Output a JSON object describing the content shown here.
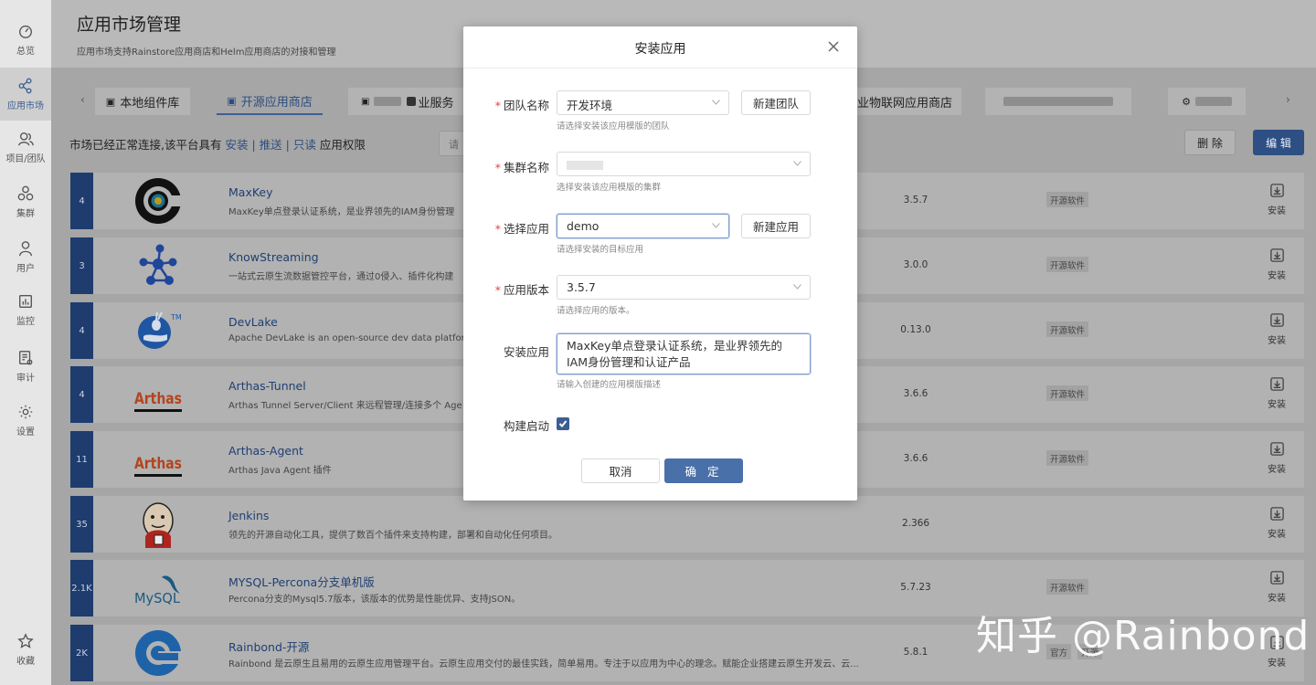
{
  "sidebar": {
    "items": [
      {
        "label": "总览",
        "icon": "dashboard-icon"
      },
      {
        "label": "应用市场",
        "icon": "share-icon"
      },
      {
        "label": "项目/团队",
        "icon": "team-icon"
      },
      {
        "label": "集群",
        "icon": "cluster-icon"
      },
      {
        "label": "用户",
        "icon": "user-icon"
      },
      {
        "label": "监控",
        "icon": "monitor-icon"
      },
      {
        "label": "审计",
        "icon": "audit-icon"
      },
      {
        "label": "设置",
        "icon": "gear-icon"
      },
      {
        "label": "收藏",
        "icon": "star-icon"
      }
    ]
  },
  "header": {
    "title": "应用市场管理",
    "description": "应用市场支持Rainstore应用商店和Helm应用商店的对接和管理"
  },
  "tabs": {
    "local": "本地组件库",
    "open_source": "开源应用商店",
    "partial_service": "业服务",
    "iot": "业物联网应用商店"
  },
  "permissions": {
    "prefix": "市场已经正常连接,该平台具有",
    "install": "安装",
    "push": "推送",
    "readonly": "只读",
    "suffix": "应用权限",
    "sep": "|"
  },
  "search": {
    "placeholder": "请"
  },
  "toolbar": {
    "delete": "删 除",
    "edit": "编 辑"
  },
  "apps": [
    {
      "count": "4",
      "name": "MaxKey",
      "desc": "MaxKey单点登录认证系统，是业界领先的IAM身份管理",
      "version": "3.5.7",
      "tags": [
        "开源软件"
      ],
      "install": "安装"
    },
    {
      "count": "3",
      "name": "KnowStreaming",
      "desc": "一站式云原生流数据管控平台，通过0侵入、插件化构建",
      "version": "3.0.0",
      "tags": [
        "开源软件"
      ],
      "install": "安装"
    },
    {
      "count": "4",
      "name": "DevLake",
      "desc": "Apache DevLake is an open-source dev data platform",
      "version": "0.13.0",
      "tags": [
        "开源软件"
      ],
      "install": "安装"
    },
    {
      "count": "4",
      "name": "Arthas-Tunnel",
      "desc": "Arthas Tunnel Server/Client 来远程管理/连接多个 Age",
      "version": "3.6.6",
      "tags": [
        "开源软件"
      ],
      "install": "安装"
    },
    {
      "count": "11",
      "name": "Arthas-Agent",
      "desc": "Arthas Java Agent 插件",
      "version": "3.6.6",
      "tags": [
        "开源软件"
      ],
      "install": "安装"
    },
    {
      "count": "35",
      "name": "Jenkins",
      "desc": "领先的开源自动化工具，提供了数百个插件来支持构建，部署和自动化任何项目。",
      "version": "2.366",
      "tags": [],
      "install": "安装"
    },
    {
      "count": "2.1K",
      "name": "MYSQL-Percona分支单机版",
      "desc": "Percona分支的Mysql5.7版本，该版本的优势是性能优异、支持JSON。",
      "version": "5.7.23",
      "tags": [
        "开源软件"
      ],
      "install": "安装"
    },
    {
      "count": "2K",
      "name": "Rainbond-开源",
      "desc": "Rainbond 是云原生且易用的云原生应用管理平台。云原生应用交付的最佳实践，简单易用。专注于以应用为中心的理念。赋能企业搭建云原生开发云、云...",
      "version": "5.8.1",
      "tags": [
        "官方",
        "开源"
      ],
      "install": "安装"
    }
  ],
  "logo_text": {
    "devlake_tm": "TM",
    "arthas": "Arthas",
    "mysql": "MySQL"
  },
  "watermark": "知乎 @Rainbond",
  "modal": {
    "title": "安装应用",
    "required_mark": "*",
    "team": {
      "label": "团队名称",
      "value": "开发环境",
      "help": "请选择安装该应用模版的团队",
      "button": "新建团队"
    },
    "cluster": {
      "label": "集群名称",
      "help": "选择安装该应用模版的集群"
    },
    "app": {
      "label": "选择应用",
      "value": "demo",
      "help": "请选择安装的目标应用",
      "button": "新建应用"
    },
    "version": {
      "label": "应用版本",
      "value": "3.5.7",
      "help": "请选择应用的版本。"
    },
    "install": {
      "label": "安装应用",
      "value": "MaxKey单点登录认证系统，是业界领先的IAM身份管理和认证产品",
      "help": "请输入创建的应用模版描述"
    },
    "build": {
      "label": "构建启动",
      "checked": true
    },
    "cancel": "取消",
    "ok": "确 定"
  },
  "colors": {
    "primary": "#3b5f93",
    "count_bg": "#1e3c6e",
    "required": "#e0463a"
  }
}
